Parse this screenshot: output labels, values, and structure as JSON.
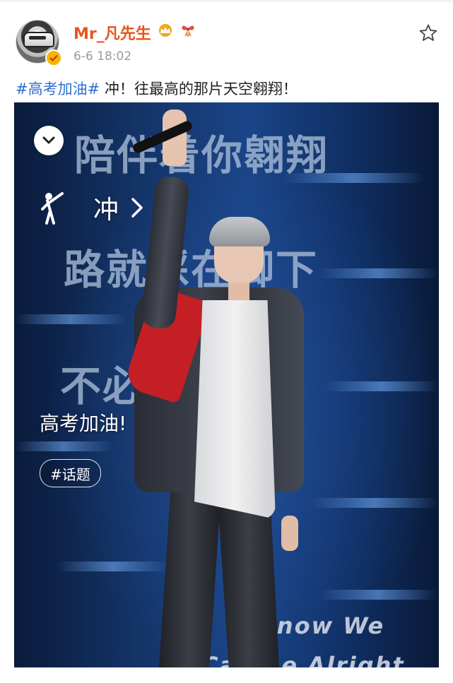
{
  "author": {
    "name": "Mr_凡先生",
    "timestamp": "6-6 18:02",
    "avatar_icon": "sports-car-avatar",
    "verified_icon": "verified-badge-icon",
    "badge_icons": [
      "crown-icon",
      "gift-bow-icon"
    ],
    "name_color": "#e8541e"
  },
  "post": {
    "hashtag": "#高考加油#",
    "text": " 冲！往最高的那片天空翱翔！",
    "hashtag_color": "#2f6fd1"
  },
  "image": {
    "background_lines": [
      "陪伴着你翱翔",
      "路就踩在脚下",
      "不必害怕",
      "Know We",
      "Can Be Alright"
    ],
    "collapse_icon": "chevron-down-icon",
    "action_icon": "cheering-person-icon",
    "action_label": "冲",
    "action_chevron": "chevron-right-icon",
    "overlay_title": "高考加油!",
    "topic_chip": "#话题"
  },
  "toolbar": {
    "favorite_icon": "star-outline-icon"
  }
}
